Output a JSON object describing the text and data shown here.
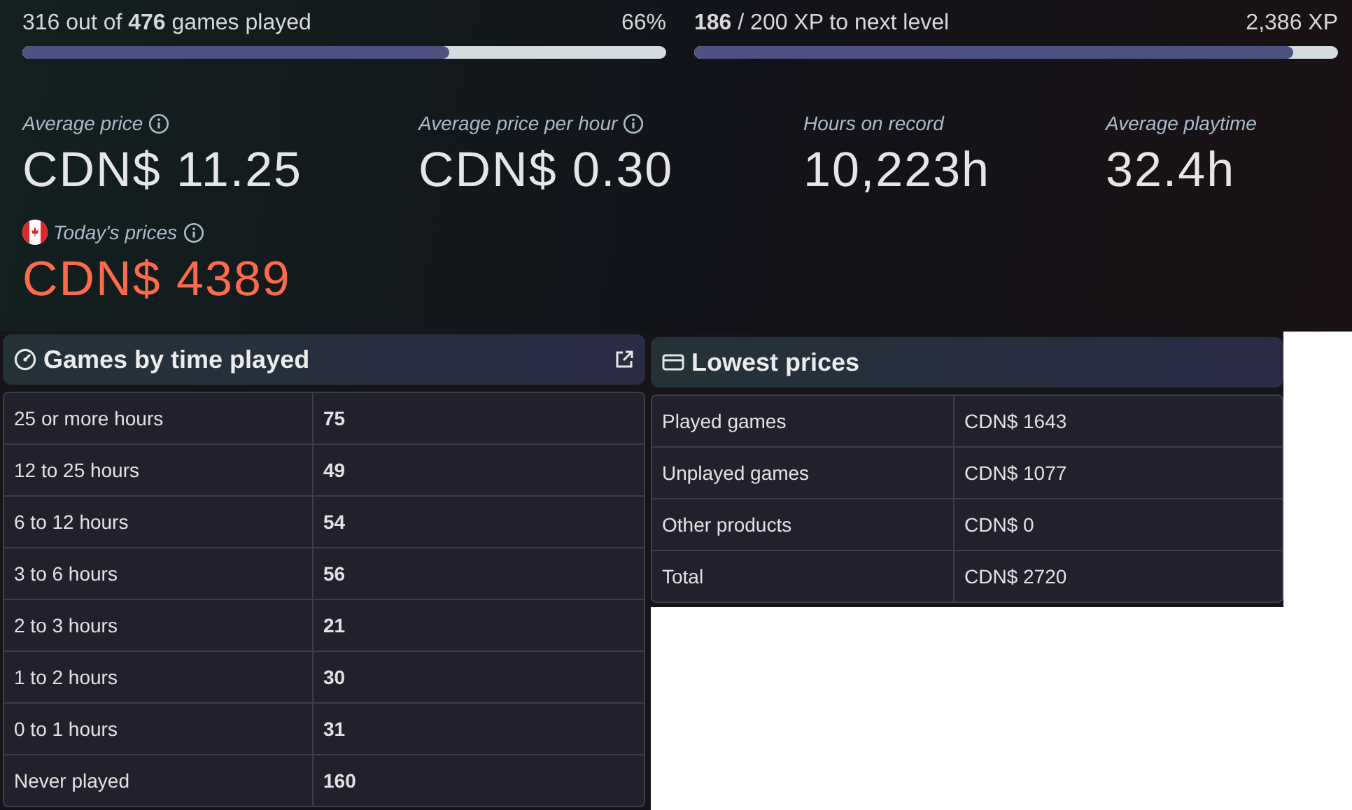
{
  "progress": [
    {
      "text": "316 out of **476** games played",
      "reading": "66%",
      "level": 0.664
    },
    {
      "text": "**186** / 200 XP to next level",
      "reading": "2,386 XP",
      "level": 0.93
    }
  ],
  "stats": [
    {
      "label": "Average price",
      "value": "CDN$ 11.25",
      "kind": "info"
    },
    {
      "label": "Average price per hour",
      "value": "CDN$ 0.30",
      "kind": "info"
    },
    {
      "label": "Hours on record",
      "value": "10,223h",
      "kind": "plain"
    },
    {
      "label": "Average playtime",
      "value": "32.4h",
      "kind": "plain"
    },
    {
      "label": "Today's prices",
      "value": "CDN$ 4389",
      "kind": "flagged"
    }
  ],
  "time_panel": {
    "title": "Games by time played",
    "rows": [
      {
        "label": "25 or more hours",
        "value": "75"
      },
      {
        "label": "12 to 25 hours",
        "value": "49"
      },
      {
        "label": "6 to 12 hours",
        "value": "54"
      },
      {
        "label": "3 to 6 hours",
        "value": "56"
      },
      {
        "label": "2 to 3 hours",
        "value": "21"
      },
      {
        "label": "1 to 2 hours",
        "value": "30"
      },
      {
        "label": "0 to 1 hours",
        "value": "31"
      },
      {
        "label": "Never played",
        "value": "160"
      }
    ]
  },
  "price_panel": {
    "title": "Lowest prices",
    "rows": [
      {
        "label": "Played games",
        "value": "CDN$ 1643"
      },
      {
        "label": "Unplayed games",
        "value": "CDN$ 1077"
      },
      {
        "label": "Other products",
        "value": "CDN$ 0"
      },
      {
        "label": "Total",
        "value": "CDN$ 2720"
      }
    ]
  }
}
